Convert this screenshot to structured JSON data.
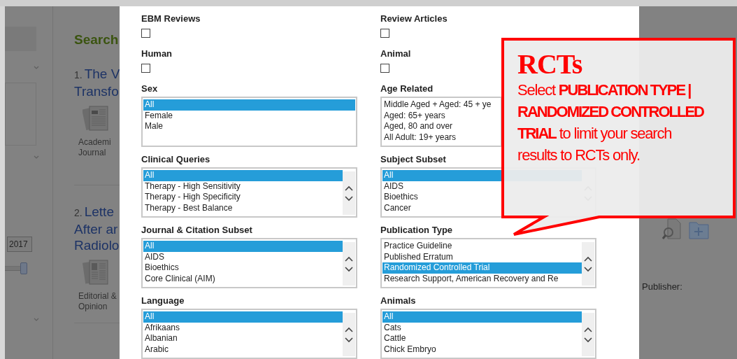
{
  "sidebar": {
    "year_field": {
      "value": "2017"
    },
    "date_slider": {
      "level": 1
    }
  },
  "results": {
    "heading": "Search",
    "items": [
      {
        "number": "1.",
        "title_lines": [
          "The V",
          "Transfo"
        ],
        "type_lines": [
          "Academi",
          "Journal"
        ],
        "kind": "journal"
      },
      {
        "number": "2.",
        "title_lines": [
          "Lette",
          "After ar",
          "Radiolo"
        ],
        "type_lines": [
          "Editorial &",
          "Opinion"
        ],
        "kind": "editorial"
      }
    ]
  },
  "dialog": {
    "filters": [
      {
        "kind": "checkbox",
        "label": "EBM Reviews",
        "checked": false
      },
      {
        "kind": "checkbox",
        "label": "Review Articles",
        "checked": false
      },
      {
        "kind": "checkbox",
        "label": "Human",
        "checked": false
      },
      {
        "kind": "checkbox",
        "label": "Animal",
        "checked": false
      },
      {
        "kind": "listbox",
        "label": "Sex",
        "scrollable": false,
        "options": [
          {
            "label": "All",
            "selected": true
          },
          {
            "label": "Female",
            "selected": false
          },
          {
            "label": "Male",
            "selected": false
          }
        ]
      },
      {
        "kind": "listbox",
        "label": "Age Related",
        "options": [
          {
            "label": "Middle Aged + Aged: 45 + ye",
            "selected": false
          },
          {
            "label": "Aged: 65+ years",
            "selected": false
          },
          {
            "label": "Aged, 80 and over",
            "selected": false
          },
          {
            "label": "All Adult: 19+ years",
            "selected": false
          }
        ]
      },
      {
        "kind": "listbox",
        "label": "Clinical Queries",
        "scrollable": true,
        "options": [
          {
            "label": "All",
            "selected": true
          },
          {
            "label": "Therapy - High Sensitivity",
            "selected": false
          },
          {
            "label": "Therapy - High Specificity",
            "selected": false
          },
          {
            "label": "Therapy - Best Balance",
            "selected": false
          }
        ]
      },
      {
        "kind": "listbox",
        "label": "Subject Subset",
        "scrollable": true,
        "options": [
          {
            "label": "All",
            "selected": true
          },
          {
            "label": "AIDS",
            "selected": false
          },
          {
            "label": "Bioethics",
            "selected": false
          },
          {
            "label": "Cancer",
            "selected": false
          }
        ]
      },
      {
        "kind": "listbox",
        "label": "Journal & Citation Subset",
        "scrollable": true,
        "options": [
          {
            "label": "All",
            "selected": true
          },
          {
            "label": "AIDS",
            "selected": false
          },
          {
            "label": "Bioethics",
            "selected": false
          },
          {
            "label": "Core Clinical (AIM)",
            "selected": false
          }
        ]
      },
      {
        "kind": "listbox",
        "label": "Publication Type",
        "scrollable": true,
        "options": [
          {
            "label": "Practice Guideline",
            "selected": false
          },
          {
            "label": "Published Erratum",
            "selected": false
          },
          {
            "label": "Randomized Controlled Trial",
            "selected": true
          },
          {
            "label": "Research Support, American Recovery and Re",
            "selected": false
          }
        ]
      },
      {
        "kind": "listbox",
        "label": "Language",
        "scrollable": true,
        "options": [
          {
            "label": "All",
            "selected": true
          },
          {
            "label": "Afrikaans",
            "selected": false
          },
          {
            "label": "Albanian",
            "selected": false
          },
          {
            "label": "Arabic",
            "selected": false
          }
        ]
      },
      {
        "kind": "listbox",
        "label": "Animals",
        "scrollable": true,
        "options": [
          {
            "label": "All",
            "selected": true
          },
          {
            "label": "Cats",
            "selected": false
          },
          {
            "label": "Cattle",
            "selected": false
          },
          {
            "label": "Chick Embryo",
            "selected": false
          }
        ]
      }
    ]
  },
  "right_panel": {
    "publisher_label": "Publisher:"
  },
  "callout": {
    "title": "RCTs",
    "text": "Select **PUBLICATION TYPE | RANDOMIZED CONTROLLED TRIAL** to limit your search results to RCTs only."
  }
}
